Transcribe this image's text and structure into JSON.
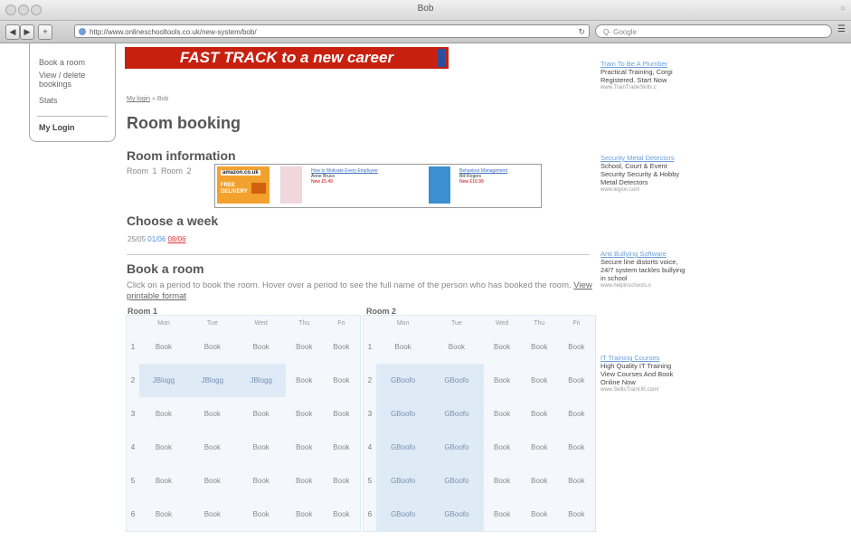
{
  "window": {
    "title": "Bob",
    "url": "http://www.onlineschooltools.co.uk/new-system/bob/",
    "search_placeholder": "Q- Google"
  },
  "leftnav": {
    "items": [
      "Book a room",
      "View / delete",
      "bookings",
      "Stats"
    ],
    "my_login": "My Login"
  },
  "banner": {
    "text": "FAST TRACK to a new career"
  },
  "breadcrumb": {
    "link": "My login",
    "sep": " » ",
    "current": "Bob"
  },
  "page_title": "Room booking",
  "room_info": {
    "heading": "Room information",
    "rooms": "Room 1  Room 2"
  },
  "ads": [
    {
      "brand": "amazon.co.uk",
      "promo": "FREE DELIVERY"
    },
    {
      "title": "How to Motivate Every Employee",
      "author": "Anne Bruce",
      "price": "New £5.49"
    },
    {
      "title": "Behaviour Management",
      "author": "Bill Rogers",
      "price": "New £16.99"
    }
  ],
  "choose_week": {
    "heading": "Choose a week",
    "week_plain": "25/05",
    "week_link": "01/06",
    "week_current": "08/06"
  },
  "book_room": {
    "heading": "Book a room",
    "intro": "Click on a period to book the room. Hover over a period to see the full name of the person who has booked the room.",
    "printable": "View printable format"
  },
  "days": [
    "Mon",
    "Tue",
    "Wed",
    "Thu",
    "Fri"
  ],
  "rooms": [
    {
      "name": "Room 1",
      "rows": [
        [
          "Book",
          "Book",
          "Book",
          "Book",
          "Book"
        ],
        [
          "JBlogg",
          "JBlogg",
          "JBlogg",
          "Book",
          "Book"
        ],
        [
          "Book",
          "Book",
          "Book",
          "Book",
          "Book"
        ],
        [
          "Book",
          "Book",
          "Book",
          "Book",
          "Book"
        ],
        [
          "Book",
          "Book",
          "Book",
          "Book",
          "Book"
        ],
        [
          "Book",
          "Book",
          "Book",
          "Book",
          "Book"
        ]
      ]
    },
    {
      "name": "Room 2",
      "rows": [
        [
          "Book",
          "Book",
          "Book",
          "Book",
          "Book"
        ],
        [
          "GBoofo",
          "GBoofo",
          "Book",
          "Book",
          "Book"
        ],
        [
          "GBoofo",
          "GBoofo",
          "Book",
          "Book",
          "Book"
        ],
        [
          "GBoofo",
          "GBoofo",
          "Book",
          "Book",
          "Book"
        ],
        [
          "GBoofo",
          "GBoofo",
          "Book",
          "Book",
          "Book"
        ],
        [
          "GBoofo",
          "GBoofo",
          "Book",
          "Book",
          "Book"
        ]
      ]
    }
  ],
  "sidebar_ads": [
    {
      "title": "Train To Be A Plumber",
      "desc": "Practical Training, Corgi Registered. Start Now",
      "url": "www.TrainTradeSkills.c"
    },
    {
      "title": "Security Metal Detectors",
      "desc": "School, Court & Event Security Security & Hobby Metal Detectors",
      "url": "www.legion.com"
    },
    {
      "title": "Anti Bullying Software",
      "desc": "Secure line distorts voice, 24/7 system tackles bullying in school",
      "url": "www.helpinschools.o"
    },
    {
      "title": "IT Training Courses",
      "desc": "High Quality IT Training View Courses And Book Online Now",
      "url": "www.SkillsTrainUK.com/"
    }
  ]
}
